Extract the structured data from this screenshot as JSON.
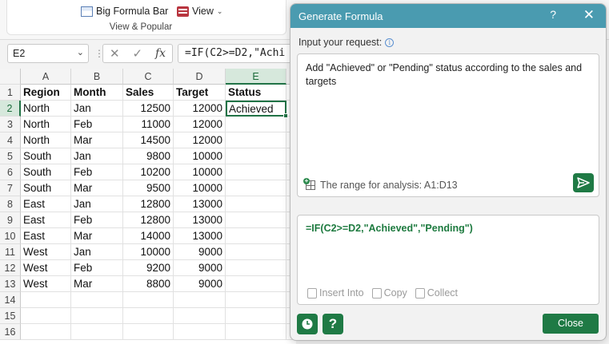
{
  "ribbon": {
    "big_formula_bar": "Big Formula Bar",
    "view": "View",
    "group_label": "View & Popular"
  },
  "formula_bar": {
    "name_box": "E2",
    "formula_preview": "=IF(C2>=D2,\"Achi"
  },
  "sheet": {
    "columns": [
      "A",
      "B",
      "C",
      "D",
      "E"
    ],
    "selected_column": "E",
    "selected_row": 2,
    "row_numbers": [
      1,
      2,
      3,
      4,
      5,
      6,
      7,
      8,
      9,
      10,
      11,
      12,
      13,
      14,
      15,
      16
    ],
    "header": [
      "Region",
      "Month",
      "Sales",
      "Target",
      "Status"
    ],
    "rows": [
      [
        "North",
        "Jan",
        "12500",
        "12000",
        "Achieved"
      ],
      [
        "North",
        "Feb",
        "11000",
        "12000",
        ""
      ],
      [
        "North",
        "Mar",
        "14500",
        "12000",
        ""
      ],
      [
        "South",
        "Jan",
        "9800",
        "10000",
        ""
      ],
      [
        "South",
        "Feb",
        "10200",
        "10000",
        ""
      ],
      [
        "South",
        "Mar",
        "9500",
        "10000",
        ""
      ],
      [
        "East",
        "Jan",
        "12800",
        "13000",
        ""
      ],
      [
        "East",
        "Feb",
        "12800",
        "13000",
        ""
      ],
      [
        "East",
        "Mar",
        "14000",
        "13000",
        ""
      ],
      [
        "West",
        "Jan",
        "10000",
        "9000",
        ""
      ],
      [
        "West",
        "Feb",
        "9200",
        "9000",
        ""
      ],
      [
        "West",
        "Mar",
        "8800",
        "9000",
        ""
      ]
    ]
  },
  "dialog": {
    "title": "Generate Formula",
    "help": "?",
    "close_x": "✕",
    "input_label": "Input your request:",
    "request_text": "Add \"Achieved\" or \"Pending\" status according to the sales and targets",
    "range_text": "The range for analysis: A1:D13",
    "result_formula": "=IF(C2>=D2,\"Achieved\",\"Pending\")",
    "actions": {
      "insert": "Insert Into",
      "copy": "Copy",
      "collect": "Collect"
    },
    "help_button": "?",
    "close_button": "Close"
  },
  "colors": {
    "accent": "#1f7a45",
    "title_bar": "#4a9bb0",
    "formula_text": "#1d7a3f"
  }
}
